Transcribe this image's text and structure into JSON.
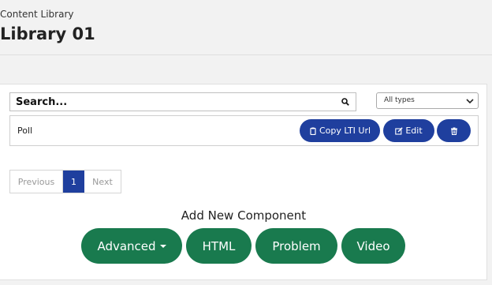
{
  "header": {
    "subtitle": "Content Library",
    "title": "Library 01"
  },
  "search": {
    "label": "Search...",
    "icon": "search-icon"
  },
  "filter": {
    "selected": "All types"
  },
  "items": [
    {
      "label": "Poll",
      "actions": {
        "copy_label": "Copy LTI Url",
        "edit_label": "Edit"
      }
    }
  ],
  "pagination": {
    "previous": "Previous",
    "current": "1",
    "next": "Next"
  },
  "add_component": {
    "title": "Add New Component",
    "buttons": {
      "advanced": "Advanced",
      "html": "HTML",
      "problem": "Problem",
      "video": "Video"
    }
  },
  "colors": {
    "primary_blue": "#1f3f9e",
    "action_green": "#197a4e",
    "background": "#f2f2f2"
  }
}
